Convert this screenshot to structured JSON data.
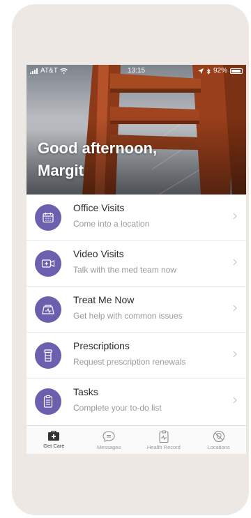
{
  "status_bar": {
    "carrier": "AT&T",
    "time": "13:15",
    "battery": "92%"
  },
  "hero": {
    "greeting": "Good afternoon,",
    "name": "Margit"
  },
  "menu": {
    "items": [
      {
        "title": "Office Visits",
        "subtitle": "Come into a location",
        "icon": "calendar-icon"
      },
      {
        "title": "Video Visits",
        "subtitle": "Talk with the med team now",
        "icon": "video-plus-icon"
      },
      {
        "title": "Treat Me Now",
        "subtitle": "Get help with common issues",
        "icon": "first-aid-kit-icon"
      },
      {
        "title": "Prescriptions",
        "subtitle": "Request prescription renewals",
        "icon": "pill-bottle-icon"
      },
      {
        "title": "Tasks",
        "subtitle": "Complete your to-do list",
        "icon": "checklist-icon"
      }
    ]
  },
  "tab_bar": {
    "tabs": [
      {
        "label": "Get Care",
        "icon": "medical-bag-icon",
        "active": true
      },
      {
        "label": "Messages",
        "icon": "chat-bubble-icon",
        "active": false
      },
      {
        "label": "Health Record",
        "icon": "clipboard-pulse-icon",
        "active": false
      },
      {
        "label": "Locations",
        "icon": "map-pin-icon",
        "active": false
      }
    ]
  },
  "colors": {
    "accent": "#6b5fae",
    "device": "#ede8e3",
    "bridge": "#a8461f"
  }
}
